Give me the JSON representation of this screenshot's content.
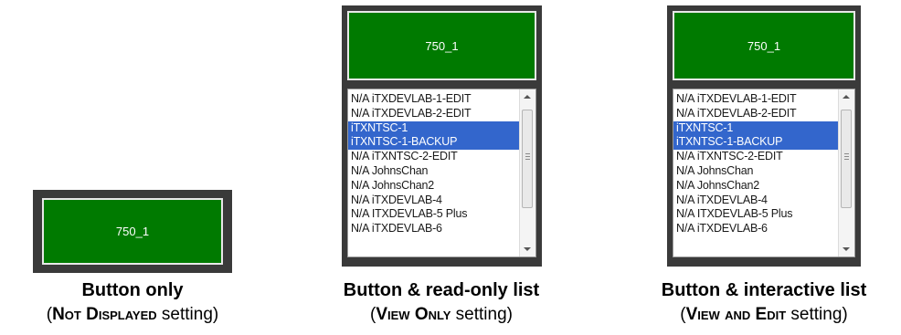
{
  "panels": [
    {
      "button_label": "750_1",
      "caption_title": "Button only",
      "caption_setting_open": "(",
      "caption_setting_name": "Not Displayed",
      "caption_setting_close": " setting)"
    },
    {
      "button_label": "750_1",
      "list_items": [
        "N/A iTXDEVLAB-1-EDIT",
        "N/A iTXDEVLAB-2-EDIT",
        "iTXNTSC-1",
        "iTXNTSC-1-BACKUP",
        "N/A iTXNTSC-2-EDIT",
        "N/A JohnsChan",
        "N/A JohnsChan2",
        "N/A iTXDEVLAB-4",
        "N/A  ITXDEVLAB-5 Plus",
        "N/A iTXDEVLAB-6"
      ],
      "caption_title": "Button & read-only list",
      "caption_setting_open": "(",
      "caption_setting_name": "View Only",
      "caption_setting_close": " setting)"
    },
    {
      "button_label": "750_1",
      "list_items": [
        "N/A iTXDEVLAB-1-EDIT",
        "N/A iTXDEVLAB-2-EDIT",
        "iTXNTSC-1",
        "iTXNTSC-1-BACKUP",
        "N/A iTXNTSC-2-EDIT",
        "N/A JohnsChan",
        "N/A JohnsChan2",
        "N/A iTXDEVLAB-4",
        "N/A  ITXDEVLAB-5 Plus",
        "N/A iTXDEVLAB-6"
      ],
      "caption_title": "Button & interactive list",
      "caption_setting_open": "(",
      "caption_setting_name": "View and Edit",
      "caption_setting_close": " setting)"
    }
  ],
  "colors": {
    "button_green": "#007a00",
    "frame_dark": "#3a3a3a",
    "selection_blue": "#3366cc"
  },
  "icons": [
    "scroll-up-arrow-icon",
    "scroll-down-arrow-icon",
    "scroll-thumb-grip-icon"
  ]
}
